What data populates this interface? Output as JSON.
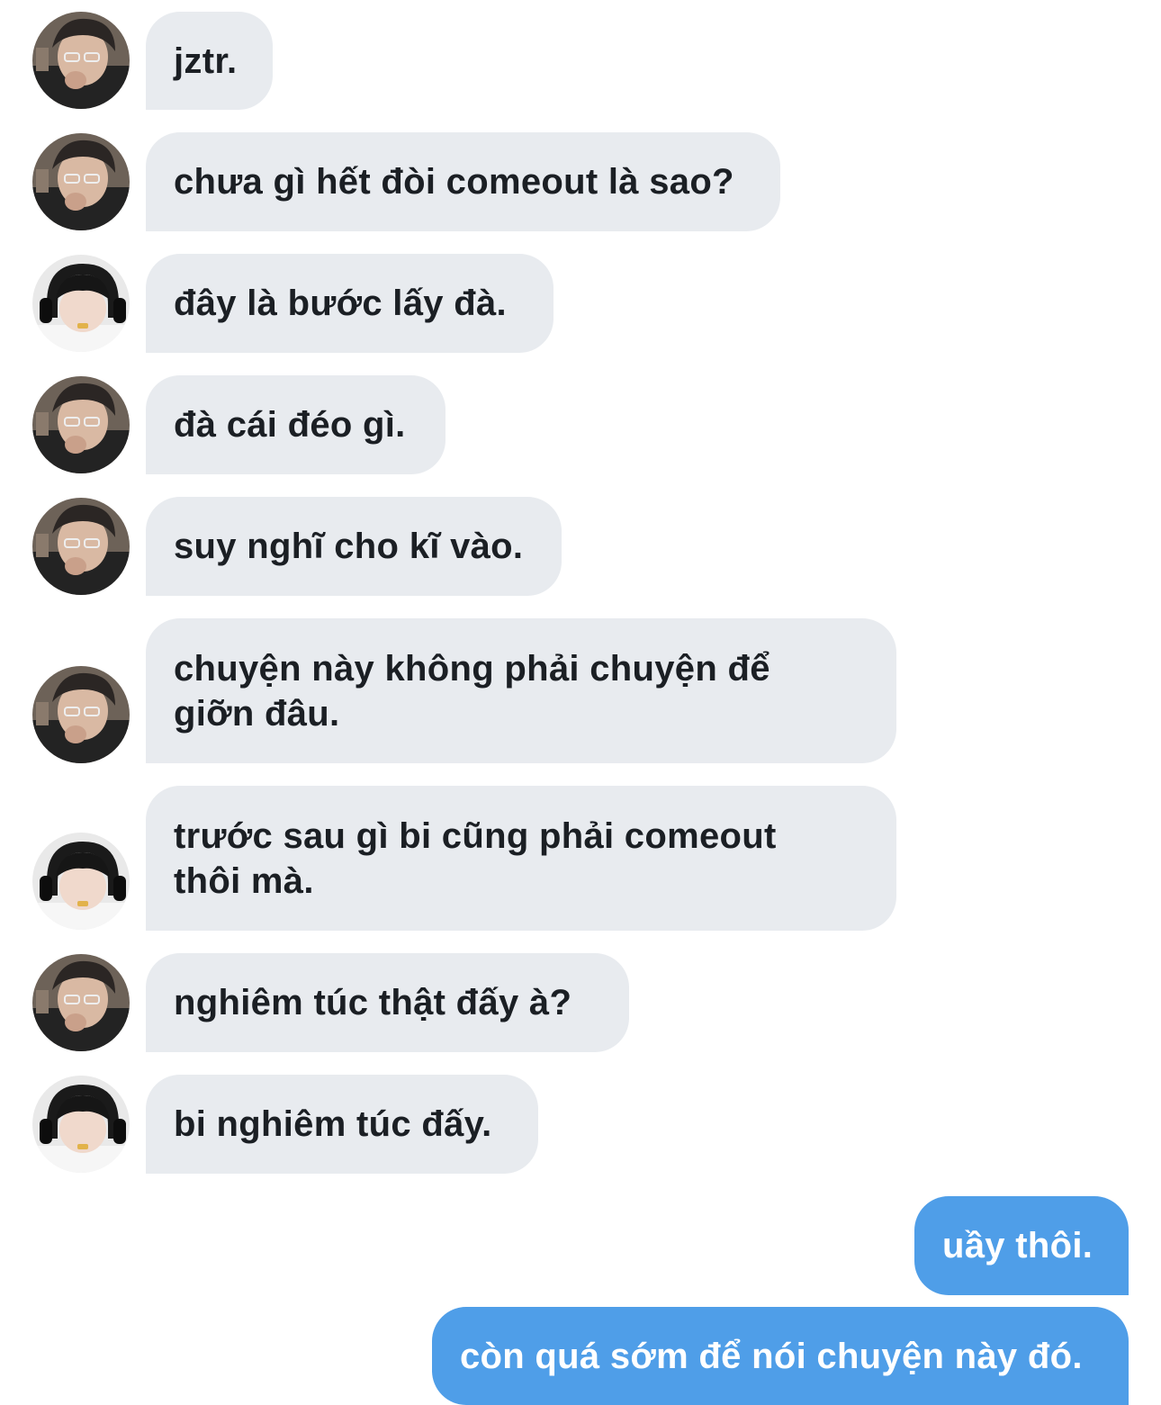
{
  "conversation": {
    "messages": [
      {
        "text": "jztr.",
        "sender": "A",
        "direction": "incoming"
      },
      {
        "text": "chưa gì hết đòi comeout là sao?",
        "sender": "A",
        "direction": "incoming"
      },
      {
        "text": "đây là bước lấy đà.",
        "sender": "B",
        "direction": "incoming"
      },
      {
        "text": "đà cái đéo gì.",
        "sender": "A",
        "direction": "incoming"
      },
      {
        "text": "suy nghĩ cho kĩ vào.",
        "sender": "A",
        "direction": "incoming"
      },
      {
        "text": "chuyện này không phải chuyện để giỡn đâu.",
        "sender": "A",
        "direction": "incoming"
      },
      {
        "text": "trước sau gì bi cũng phải comeout thôi mà.",
        "sender": "B",
        "direction": "incoming"
      },
      {
        "text": "nghiêm túc thật đấy à?",
        "sender": "A",
        "direction": "incoming"
      },
      {
        "text": "bi nghiêm túc đấy.",
        "sender": "B",
        "direction": "incoming"
      },
      {
        "text": "uầy thôi.",
        "sender": "me",
        "direction": "outgoing"
      },
      {
        "text": "còn quá sớm để nói chuyện này đó.",
        "sender": "me",
        "direction": "outgoing"
      }
    ]
  },
  "colors": {
    "incoming_bubble": "#e8ebef",
    "incoming_text": "#1b1f24",
    "outgoing_bubble": "#4f9ee8",
    "outgoing_text": "#ffffff"
  },
  "icons": {
    "avatar_a": "avatar-photo-icon",
    "avatar_b": "avatar-photo-headset-icon"
  }
}
